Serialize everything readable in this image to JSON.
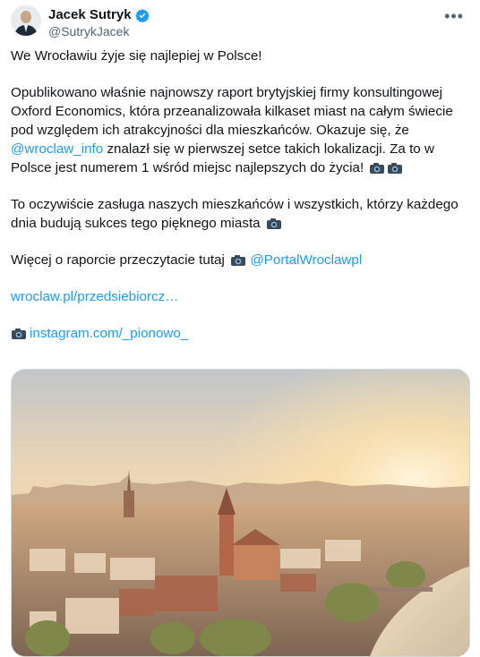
{
  "author": {
    "display_name": "Jacek Sutryk",
    "handle": "@SutrykJacek",
    "verified": true
  },
  "more_icon": "more-horizontal-icon",
  "tweet": {
    "line1": "We Wrocławiu żyje się najlepiej w Polsce!",
    "p2_a": "Opublikowano właśnie najnowszy raport brytyjskiej firmy konsultingowej Oxford Economics, która przeanalizowała kilkaset miast na całym świecie pod względem ich atrakcyjności dla mieszkańców. Okazuje się, że ",
    "p2_mention": "@wroclaw_info",
    "p2_b": " znalazł się w pierwszej setce takich lokalizacji. Za to w Polsce jest numerem 1 wśród miejsc najlepszych do życia!",
    "p3": "To oczywiście zasługa naszych mieszkańców i wszystkich, którzy każdego dnia budują sukces tego pięknego miasta",
    "p4": "Więcej o raporcie przeczytacie tutaj",
    "p4_mention": "@PortalWroclawpl",
    "link1": "wroclaw.pl/przedsiebiorcz…",
    "link2": "instagram.com/_pionowo_"
  },
  "icons": {
    "camera": "camera-emoji-icon",
    "verified": "verified-badge-icon"
  },
  "colors": {
    "link": "#1d9bf0",
    "text": "#0f1419",
    "muted": "#536471"
  }
}
